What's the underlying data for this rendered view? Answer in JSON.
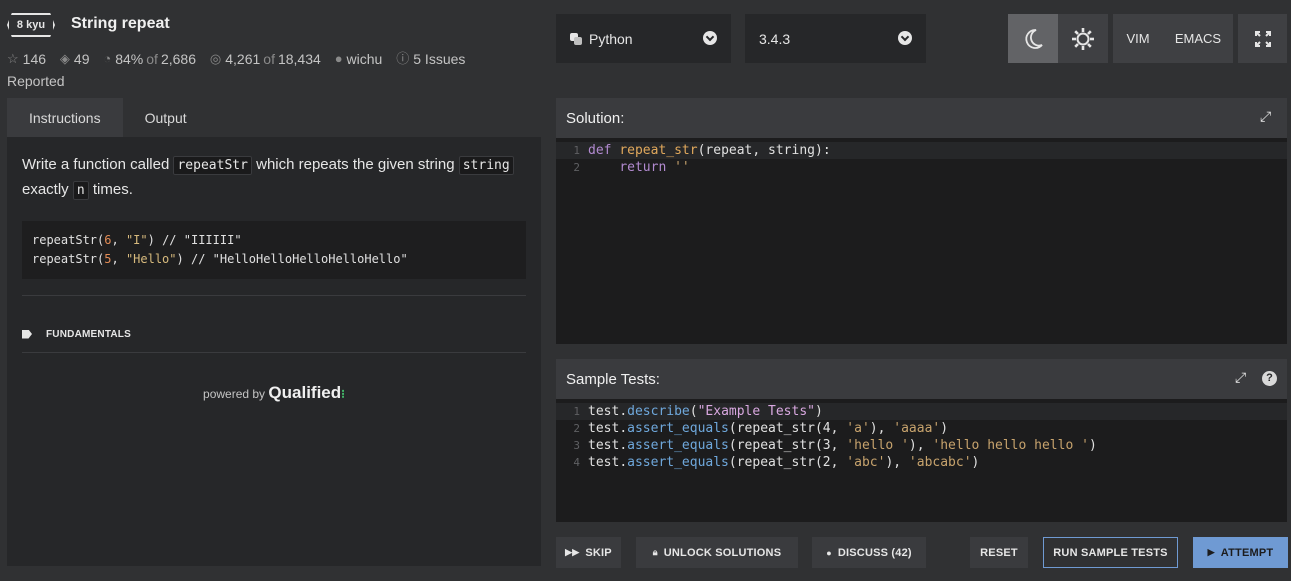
{
  "header": {
    "kyu": "8 kyu",
    "title": "String repeat",
    "stats": {
      "stars": "146",
      "collections": "49",
      "satisfaction": "84%",
      "satisfaction_of": "of",
      "satisfaction_votes": "2,686",
      "completed": "4,261",
      "completed_of": "of",
      "attempted": "18,434",
      "author": "wichu",
      "issues": "5 Issues",
      "reported": "Reported"
    },
    "language": "Python",
    "version": "3.4.3",
    "buttons": {
      "vim": "VIM",
      "emacs": "EMACS"
    }
  },
  "left": {
    "tabs": [
      {
        "label": "Instructions"
      },
      {
        "label": "Output"
      }
    ],
    "desc": {
      "p1": "Write a function called",
      "code1": "repeatStr",
      "p2": "which repeats the given string",
      "code2": "string",
      "p3": "exactly",
      "code3": "n",
      "p4": "times."
    },
    "example": {
      "l1_fn": "repeatStr(",
      "l1_num": "6",
      "l1_sep": ", ",
      "l1_str": "\"I\"",
      "l1_end": ") // \"IIIIII\"",
      "l2_fn": "repeatStr(",
      "l2_num": "5",
      "l2_sep": ", ",
      "l2_str": "\"Hello\"",
      "l2_end": ") // \"HelloHelloHelloHelloHello\""
    },
    "tag": "FUNDAMENTALS",
    "powered_by": "powered by",
    "powered_brand": "Qualified"
  },
  "solution": {
    "title": "Solution:",
    "lines": [
      {
        "n": "1",
        "kw": "def",
        "fn": "repeat_str",
        "rest": "(repeat, string):"
      },
      {
        "n": "2",
        "kw": "return",
        "str": "''"
      }
    ]
  },
  "tests": {
    "title": "Sample Tests:",
    "help": "?",
    "lines": [
      {
        "n": "1",
        "obj": "test",
        "dot": ".",
        "m": "describe",
        "a": "(",
        "s": "\"Example Tests\"",
        "b": ")"
      },
      {
        "n": "2",
        "obj": "test",
        "dot": ".",
        "m": "assert_equals",
        "a": "(repeat_str(4, ",
        "s1": "'a'",
        "mid": "), ",
        "s2": "'aaaa'",
        "b": ")"
      },
      {
        "n": "3",
        "obj": "test",
        "dot": ".",
        "m": "assert_equals",
        "a": "(repeat_str(3, ",
        "s1": "'hello '",
        "mid": "), ",
        "s2": "'hello hello hello '",
        "b": ")"
      },
      {
        "n": "4",
        "obj": "test",
        "dot": ".",
        "m": "assert_equals",
        "a": "(repeat_str(2, ",
        "s1": "'abc'",
        "mid": "), ",
        "s2": "'abcabc'",
        "b": ")"
      }
    ]
  },
  "actions": {
    "skip": "SKIP",
    "unlock": "UNLOCK SOLUTIONS",
    "discuss": "DISCUSS (42)",
    "reset": "RESET",
    "run": "RUN SAMPLE TESTS",
    "attempt": "ATTEMPT"
  }
}
